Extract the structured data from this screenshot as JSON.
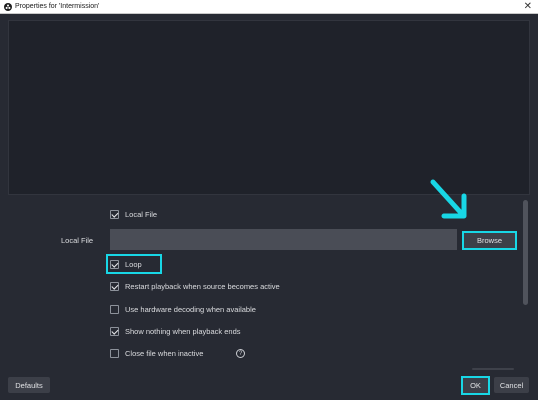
{
  "window": {
    "title": "Properties for 'Intermission'",
    "close_glyph": "✕",
    "icon": "obs-icon"
  },
  "form": {
    "local_file_checkbox": {
      "label": "Local File",
      "checked": true
    },
    "local_file_field": {
      "label": "Local File",
      "value": ""
    },
    "browse_label": "Browse",
    "options": [
      {
        "label": "Loop",
        "checked": true
      },
      {
        "label": "Restart playback when source becomes active",
        "checked": true
      },
      {
        "label": "Use hardware decoding when available",
        "checked": false
      },
      {
        "label": "Show nothing when playback ends",
        "checked": true
      },
      {
        "label": "Close file when inactive",
        "checked": false
      }
    ],
    "help_glyph": "?"
  },
  "footer": {
    "defaults_label": "Defaults",
    "ok_label": "OK",
    "cancel_label": "Cancel"
  },
  "colors": {
    "highlight": "#18d7e6",
    "background": "#272a33",
    "button": "#3c3f48"
  }
}
